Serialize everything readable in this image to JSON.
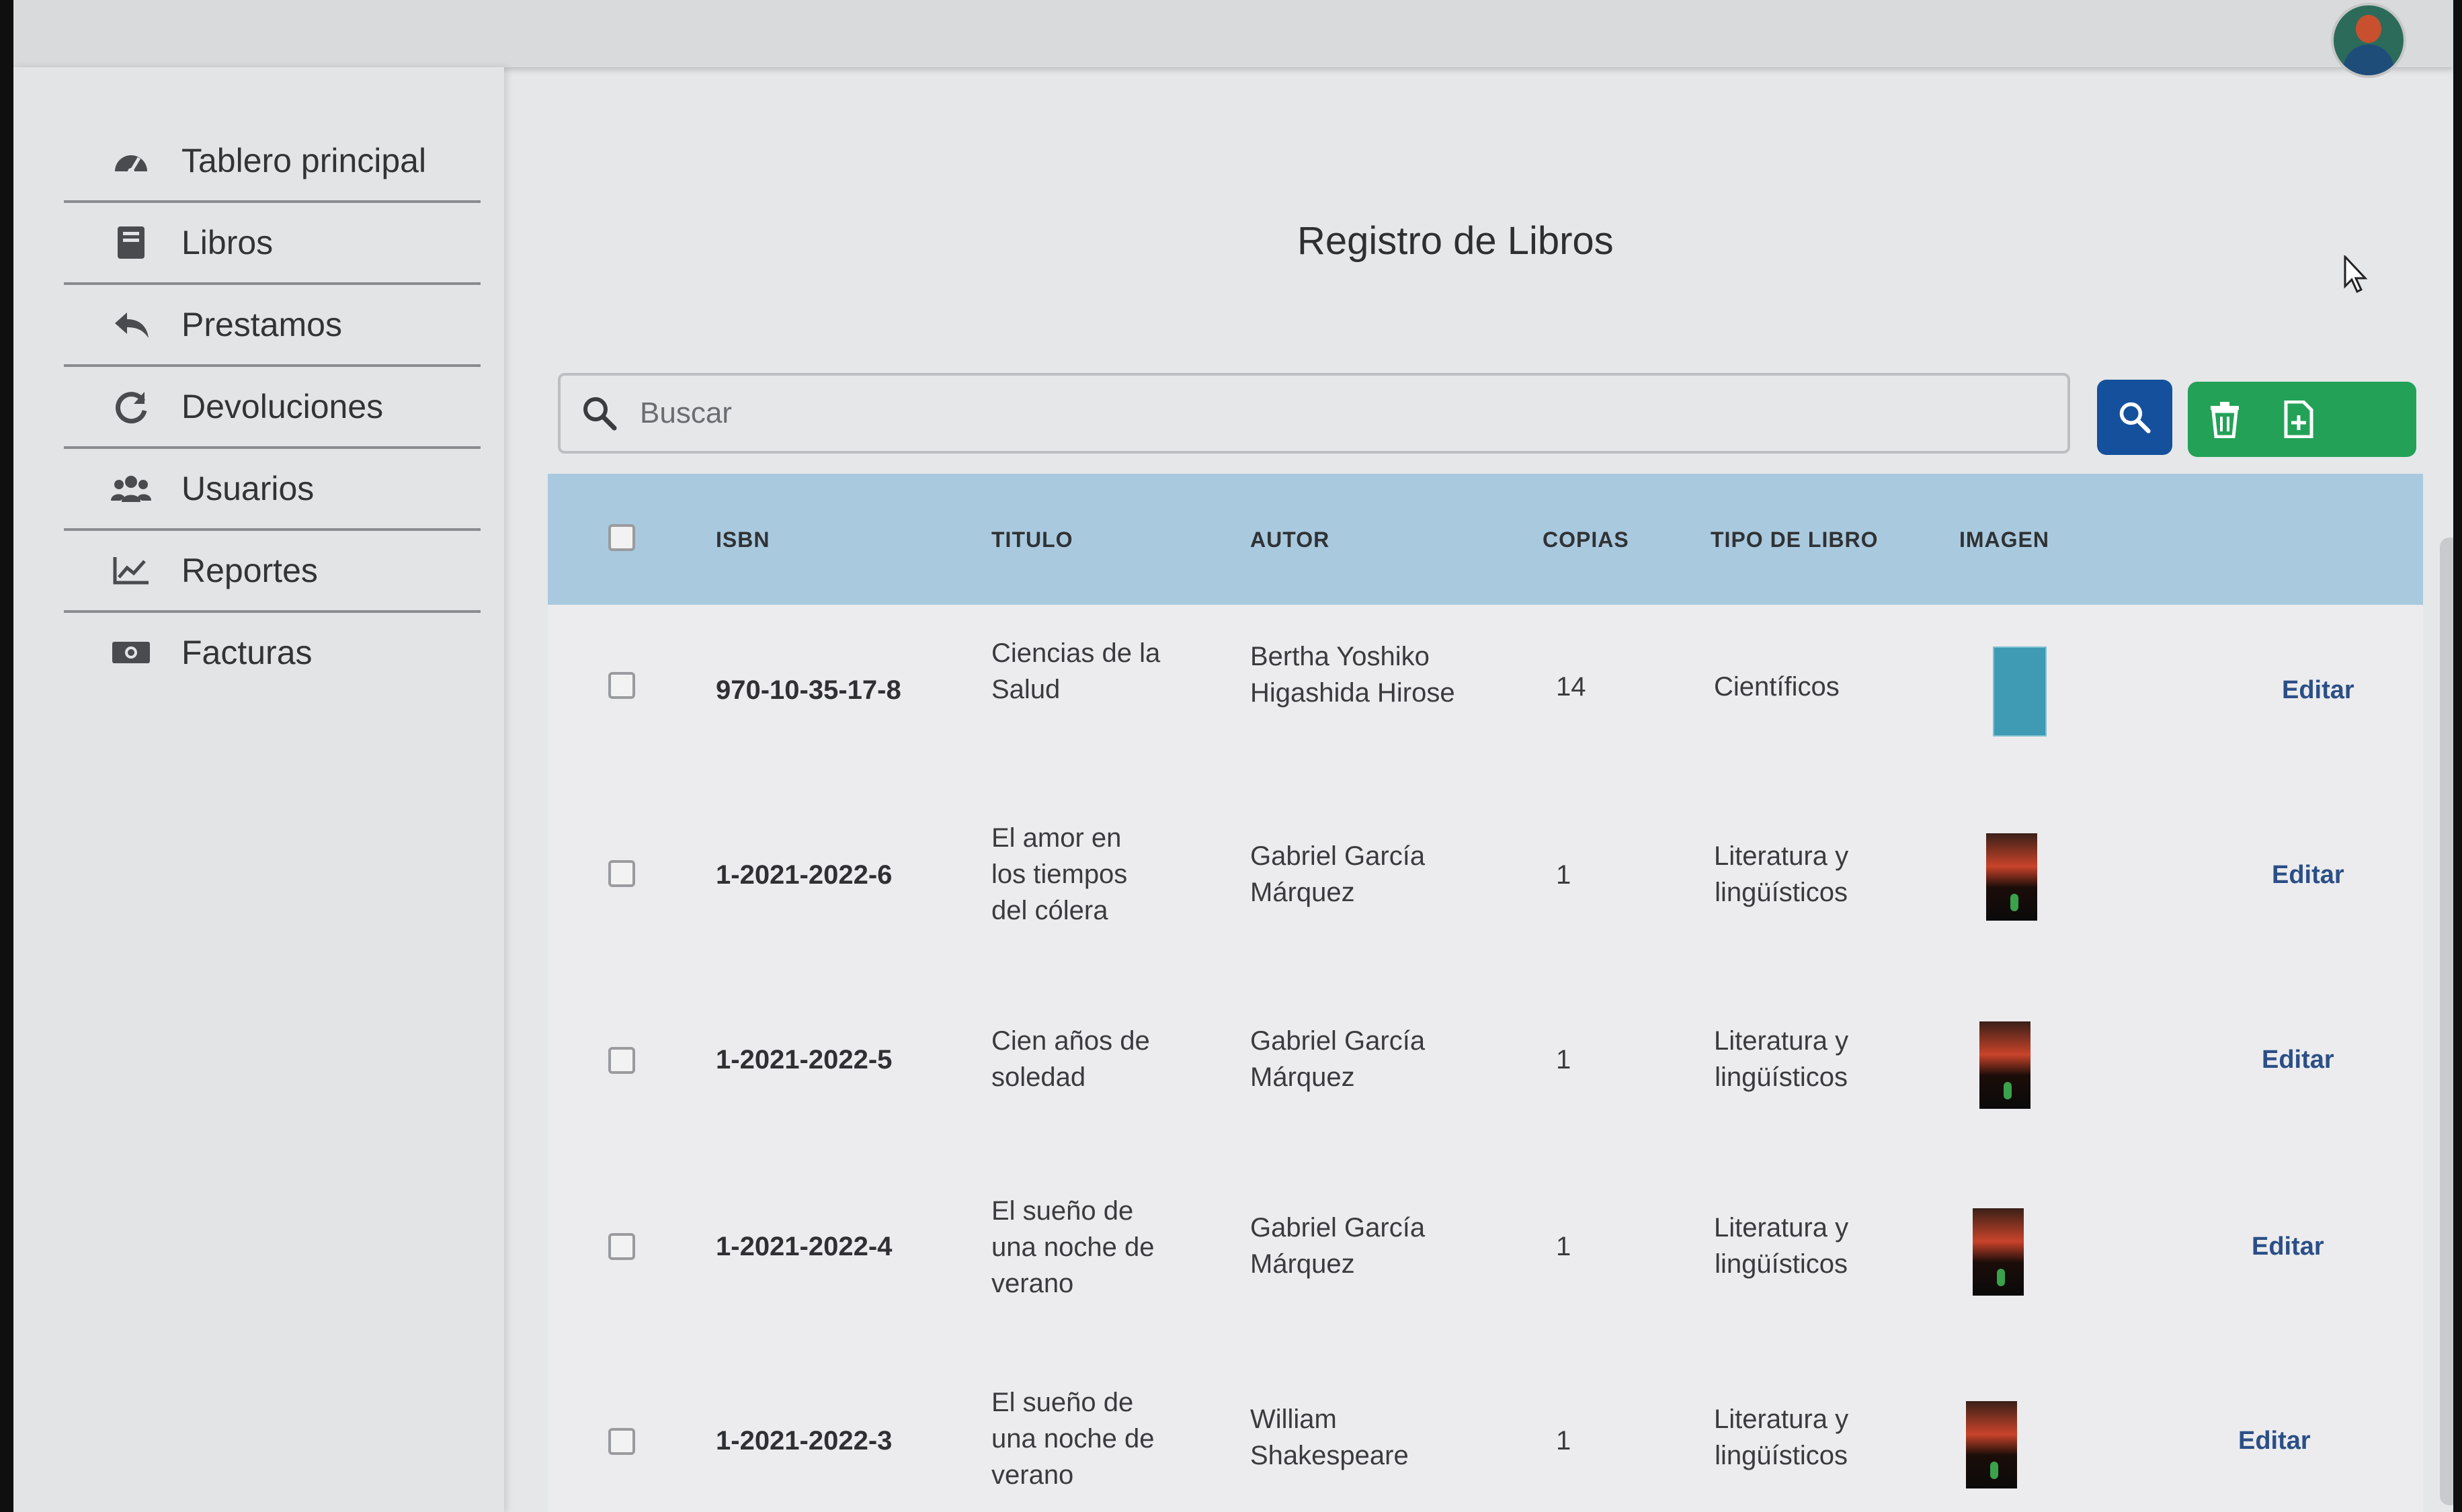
{
  "sidebar": {
    "items": [
      {
        "label": "Tablero principal",
        "icon": "dashboard-gauge-icon"
      },
      {
        "label": "Libros",
        "icon": "book-icon"
      },
      {
        "label": "Prestamos",
        "icon": "reply-arrow-icon"
      },
      {
        "label": "Devoluciones",
        "icon": "redo-arrow-icon"
      },
      {
        "label": "Usuarios",
        "icon": "users-icon"
      },
      {
        "label": "Reportes",
        "icon": "chart-line-icon"
      },
      {
        "label": "Facturas",
        "icon": "money-bill-icon"
      }
    ]
  },
  "main": {
    "title": "Registro de Libros",
    "search": {
      "placeholder": "Buscar"
    },
    "buttons": {
      "search": "search-icon",
      "delete": "trash-icon",
      "new": "file-plus-icon"
    },
    "colors": {
      "search_button": "#14509c",
      "action_group": "#23a257",
      "header": "#a9c9df"
    }
  },
  "table": {
    "columns": [
      "ISBN",
      "TITULO",
      "AUTOR",
      "COPIAS",
      "TIPO DE LIBRO",
      "IMAGEN"
    ],
    "rows": [
      {
        "isbn": "970-10-35-17-8",
        "titulo": [
          "Ciencias de la",
          "Salud"
        ],
        "autor": [
          "Bertha Yoshiko",
          "Higashida Hirose"
        ],
        "copias": "14",
        "tipo": [
          "Científicos"
        ],
        "edit": "Editar"
      },
      {
        "isbn": "1-2021-2022-6",
        "titulo": [
          "El amor en",
          "los tiempos",
          "del cólera"
        ],
        "autor": [
          "Gabriel García",
          "Márquez"
        ],
        "copias": "1",
        "tipo": [
          "Literatura y",
          "lingüísticos"
        ],
        "edit": "Editar"
      },
      {
        "isbn": "1-2021-2022-5",
        "titulo": [
          "Cien años de",
          "soledad"
        ],
        "autor": [
          "Gabriel García",
          "Márquez"
        ],
        "copias": "1",
        "tipo": [
          "Literatura y",
          "lingüísticos"
        ],
        "edit": "Editar"
      },
      {
        "isbn": "1-2021-2022-4",
        "titulo": [
          "El sueño de",
          "una noche de",
          "verano"
        ],
        "autor": [
          "Gabriel García",
          "Márquez"
        ],
        "copias": "1",
        "tipo": [
          "Literatura y",
          "lingüísticos"
        ],
        "edit": "Editar"
      },
      {
        "isbn": "1-2021-2022-3",
        "titulo": [
          "El sueño de",
          "una noche de",
          "verano"
        ],
        "autor": [
          "William",
          "Shakespeare"
        ],
        "copias": "1",
        "tipo": [
          "Literatura y",
          "lingüísticos"
        ],
        "edit": "Editar"
      }
    ]
  }
}
